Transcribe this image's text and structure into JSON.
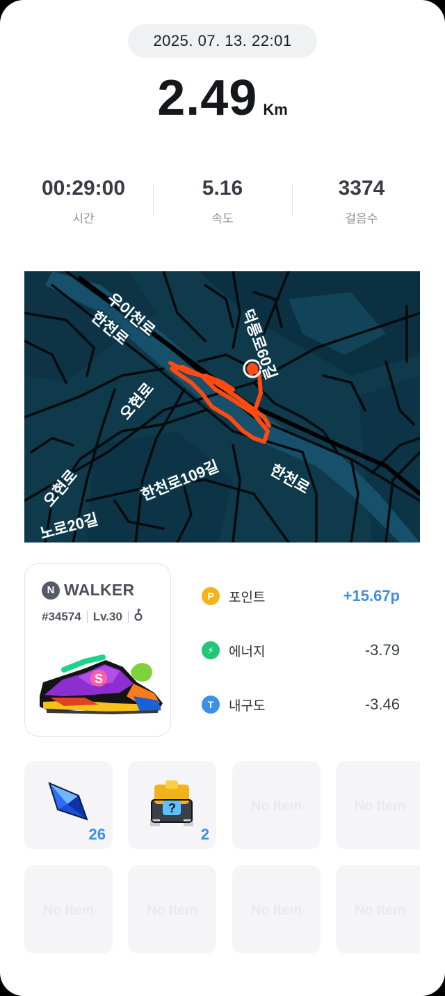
{
  "header": {
    "datetime": "2025. 07. 13. 22:01",
    "distance": "2.49",
    "distance_unit": "Km"
  },
  "stats": [
    {
      "value": "00:29:00",
      "label": "시간"
    },
    {
      "value": "5.16",
      "label": "속도"
    },
    {
      "value": "3374",
      "label": "걸음수"
    }
  ],
  "map": {
    "road_labels": [
      "우이천로",
      "한천로",
      "오현로",
      "덕릉로60길",
      "한천로109길",
      "한천로",
      "오현로",
      "노로20길"
    ],
    "route_color": "#ff4a12",
    "background_color": "#0f3a4c"
  },
  "shoe": {
    "brand_badge": "N",
    "brand": "WALKER",
    "id": "#34574",
    "level": "Lv.30",
    "trailing_icon": "gender-icon"
  },
  "rewards": [
    {
      "icon": "P",
      "label": "포인트",
      "value": "+15.67p",
      "color": "#f5b31a"
    },
    {
      "icon": "⚡",
      "label": "에너지",
      "value": "-3.79",
      "color": "#1fc77a"
    },
    {
      "icon": "T",
      "label": "내구도",
      "value": "-3.46",
      "color": "#3b8fe6"
    }
  ],
  "items": [
    {
      "name": "blue-crystal",
      "count": "26"
    },
    {
      "name": "mystery-box",
      "count": "2"
    },
    {
      "empty": "No Item"
    },
    {
      "empty": "No Item"
    },
    {
      "empty": "No Item"
    },
    {
      "empty": "No Item"
    },
    {
      "empty": "No Item"
    },
    {
      "empty": "No Item"
    }
  ]
}
